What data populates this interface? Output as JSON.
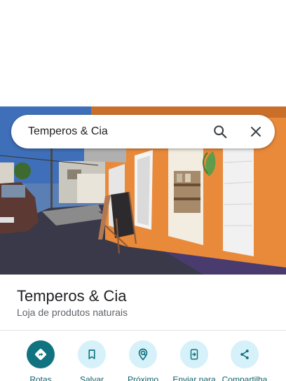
{
  "search": {
    "query": "Temperos & Cia",
    "search_icon": "search-icon",
    "close_icon": "close-icon"
  },
  "photo": {
    "kind": "storefront-photo"
  },
  "place": {
    "name": "Temperos & Cia",
    "category": "Loja de produtos naturais"
  },
  "actions": [
    {
      "label": "Rotas",
      "icon": "directions-icon",
      "primary": true
    },
    {
      "label": "Salvar",
      "icon": "bookmark-icon",
      "primary": false
    },
    {
      "label": "Próximo",
      "icon": "nearby-icon",
      "primary": false
    },
    {
      "label": "Enviar para",
      "icon": "send-to-phone-icon",
      "primary": false
    },
    {
      "label": "Compartilha",
      "icon": "share-icon",
      "primary": false
    }
  ],
  "colors": {
    "primary_action": "#11737f",
    "secondary_action_bg": "#d6f1f9",
    "action_label": "#0b616c",
    "storefront_wall": "#e98a3a"
  }
}
